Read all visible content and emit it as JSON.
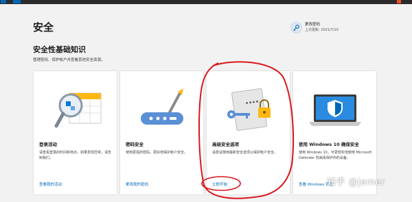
{
  "page": {
    "title": "安全"
  },
  "change_password": {
    "label": "更改密码",
    "last_updated": "上次更新: 2021/7/10",
    "icon": "key-icon"
  },
  "basics": {
    "title": "安全性基础知识",
    "description": "管理密码、保护帐户并查看其他安全资源。"
  },
  "cards": [
    {
      "icon": "magnifier-calendar-icon",
      "title": "登录活动",
      "description": "请查看登录的时间和地点。如果发现异常，请告知我们。",
      "link": "查看我的活动"
    },
    {
      "icon": "password-device-icon",
      "title": "密码安全",
      "description": "使用更强的密码，更好地保护帐户安全。",
      "link": "更改我的密码"
    },
    {
      "icon": "key-lock-document-icon",
      "title": "高级安全选项",
      "description": "请尝试使用最新安全选项以保护帐户安全。",
      "link": "立即开始"
    },
    {
      "icon": "laptop-shield-icon",
      "title": "使用 Windows 10 确保安全",
      "description": "使用 Windows 10，可更轻松地使用 Microsoft Defender 防病毒保护你的设备。",
      "link": "查看 Windows 安全"
    }
  ],
  "watermark": "知乎 @jemer",
  "colors": {
    "accent": "#0067b8",
    "background": "#f2f2f2",
    "annotation": "#d9161b"
  }
}
